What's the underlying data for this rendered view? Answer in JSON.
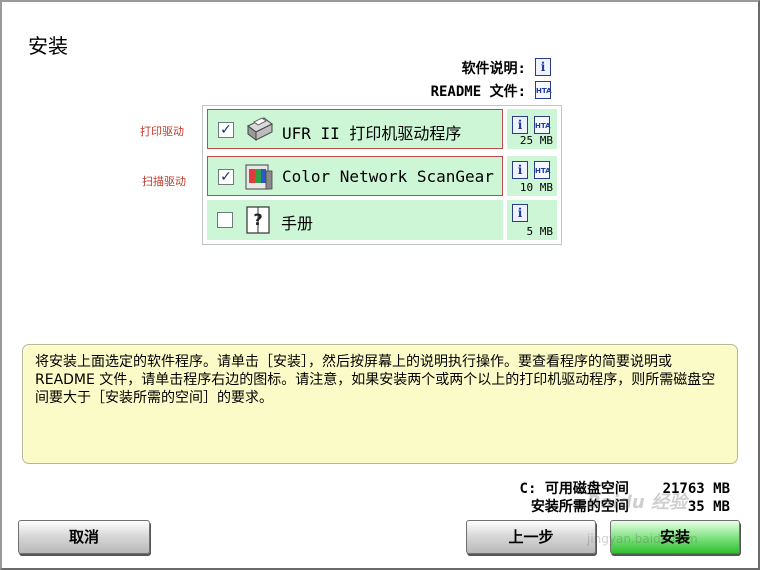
{
  "title": "安装",
  "info": {
    "software_desc_label": "软件说明:",
    "readme_label": "README 文件:"
  },
  "annotations": {
    "print_driver": "打印驱动",
    "scan_driver": "扫描驱动"
  },
  "components": [
    {
      "label": "UFR II 打印机驱动程序",
      "checked": true,
      "size": "25 MB",
      "icon": "printer-icon"
    },
    {
      "label": "Color Network ScanGear",
      "checked": true,
      "size": "10 MB",
      "icon": "scanner-icon"
    },
    {
      "label": "手册",
      "checked": false,
      "size": "5 MB",
      "icon": "manual-book-icon"
    }
  ],
  "description": "将安装上面选定的软件程序。请单击［安装］，然后按屏幕上的说明执行操作。要查看程序的简要说明或 README 文件，请单击程序右边的图标。请注意，如果安装两个或两个以上的打印机驱动程序，则所需磁盘空间要大于［安装所需的空间］的要求。",
  "disk": {
    "available_label": "C: 可用磁盘空间",
    "available_value": "21763 MB",
    "required_label": "安装所需的空间",
    "required_value": "35 MB"
  },
  "buttons": {
    "cancel": "取消",
    "back": "上一步",
    "install": "安装"
  },
  "watermark": {
    "brand": "Baidu 经验",
    "url": "jingyan.baidu.com"
  },
  "colors": {
    "row_bg": "#cdf6d6",
    "desc_bg": "#fbfbc8",
    "annotation": "#c0392b",
    "next_button": "#2fc02f"
  }
}
